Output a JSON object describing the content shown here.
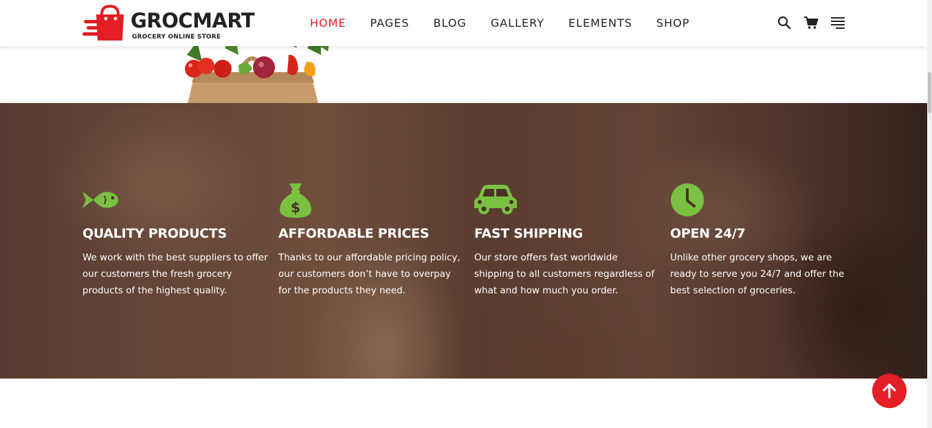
{
  "brand": {
    "name": "GROCMART",
    "tagline": "GROCERY ONLINE STORE",
    "accent_color": "#e31e24"
  },
  "nav": {
    "items": [
      {
        "label": "HOME",
        "active": true
      },
      {
        "label": "PAGES",
        "active": false
      },
      {
        "label": "BLOG",
        "active": false
      },
      {
        "label": "GALLERY",
        "active": false
      },
      {
        "label": "ELEMENTS",
        "active": false
      },
      {
        "label": "SHOP",
        "active": false
      }
    ]
  },
  "header_icons": [
    "search-icon",
    "cart-icon",
    "menu-icon"
  ],
  "features": {
    "icon_color": "#7ac142",
    "items": [
      {
        "icon": "fish-icon",
        "title": "QUALITY PRODUCTS",
        "text": "We work with the best suppliers to offer our customers the fresh grocery products of the highest quality."
      },
      {
        "icon": "money-bag-icon",
        "title": "AFFORDABLE PRICES",
        "text": "Thanks to our affordable pricing policy, our customers don’t have to overpay for the products they need."
      },
      {
        "icon": "car-icon",
        "title": "FAST SHIPPING",
        "text": "Our store offers fast worldwide shipping to all customers regardless of what and how much you order."
      },
      {
        "icon": "clock-icon",
        "title": "OPEN 24/7",
        "text": "Unlike other grocery shops, we are ready to serve you 24/7 and offer the best selection of groceries."
      }
    ]
  },
  "scroll_to_top": {
    "icon": "arrow-up-icon"
  }
}
